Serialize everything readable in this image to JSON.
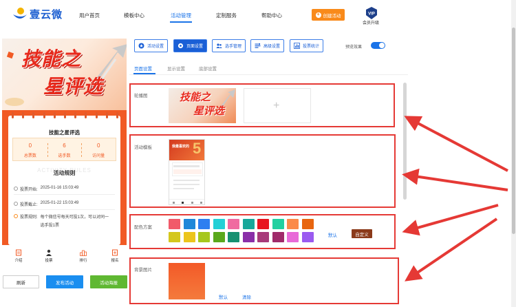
{
  "brand": {
    "name": "壹云微"
  },
  "nav": {
    "items": [
      {
        "label": "用户首页"
      },
      {
        "label": "模板中心"
      },
      {
        "label": "活动管理"
      },
      {
        "label": "定制服务"
      },
      {
        "label": "帮助中心"
      }
    ],
    "active_index": 2,
    "create_label": "创建活动",
    "vip_badge": "VIP",
    "vip_label": "会员升级"
  },
  "preview": {
    "banner_line1": "技能之",
    "banner_line2": "星评选",
    "card_title": "技能之星评选",
    "stats": [
      {
        "value": "0",
        "label": "总票数"
      },
      {
        "value": "6",
        "label": "选手数"
      },
      {
        "value": "0",
        "label": "访问量"
      }
    ],
    "rules_ghost": "ACTIVITY RULES",
    "rules_title": "活动规则",
    "rules": [
      {
        "label": "投票开始:",
        "value": "2025-01-16 15:03:49"
      },
      {
        "label": "投票截止:",
        "value": "2025-01-22 15:03:49"
      },
      {
        "label": "投票规则:",
        "value": "每个微信号每天可投1次，可以对同一",
        "value2": "选手投1票"
      }
    ],
    "tabs": [
      {
        "label": "介绍"
      },
      {
        "label": "投票"
      },
      {
        "label": "排行"
      },
      {
        "label": "报名"
      }
    ],
    "refresh_label": "刷新",
    "publish_label": "发布活动",
    "poster_label": "活动海报"
  },
  "toolbar": {
    "buttons": [
      {
        "label": "活动设置",
        "icon": "star-circle-icon"
      },
      {
        "label": "页面设置",
        "icon": "gear-icon"
      },
      {
        "label": "选手管理",
        "icon": "users-icon"
      },
      {
        "label": "高级设置",
        "icon": "sliders-icon"
      },
      {
        "label": "投票统计",
        "icon": "bar-chart-icon"
      }
    ],
    "active_index": 1,
    "preview_label": "预览效果",
    "preview_on": true
  },
  "subtabs": {
    "items": [
      {
        "label": "页面设置"
      },
      {
        "label": "显示设置"
      },
      {
        "label": "底部设置"
      }
    ],
    "active_index": 0
  },
  "sections": {
    "carousel_label": "轮播图",
    "carousel_image_line1": "技能之",
    "carousel_image_line2": "星评选",
    "template_label": "活动模板",
    "template_thumb_title": "我最喜欢的",
    "template_thumb_big": "5",
    "color_label": "配色方案",
    "colors": [
      "#f15a6a",
      "#1f87d9",
      "#2e7ff0",
      "#23d0d6",
      "#f06aa0",
      "#17a89a",
      "#e8141e",
      "#22d0a0",
      "#fb8a4a",
      "#e8650f",
      "#d4c71c",
      "#ecc51c",
      "#a6c71c",
      "#5aa81c",
      "#179070",
      "#8a2ea8",
      "#a83a7a",
      "#a02a6a",
      "#e86ad8",
      "#9a5af0"
    ],
    "default_label": "默认",
    "custom_label": "自定义",
    "bg_label": "背景图片",
    "bg_default_label": "默认",
    "bg_clear_label": "清除"
  }
}
